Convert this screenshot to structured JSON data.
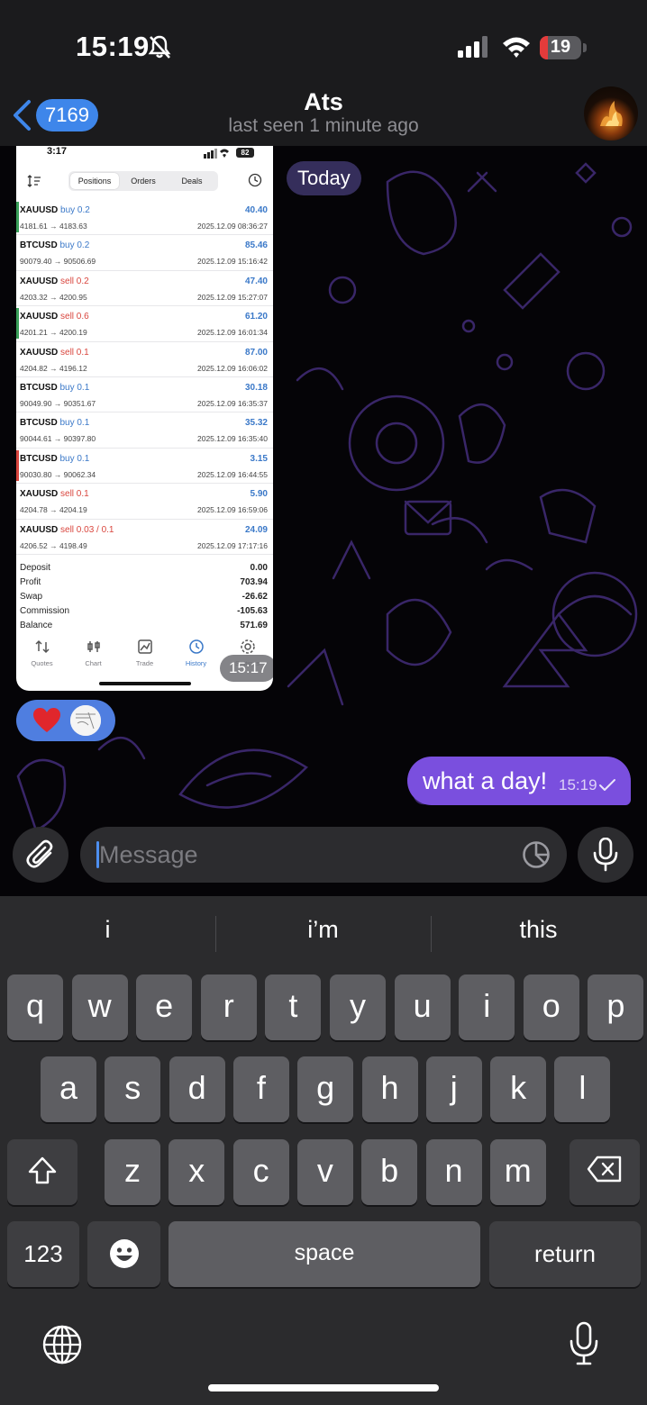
{
  "status_bar": {
    "time": "15:19",
    "battery": "19",
    "battery_level": 0.19
  },
  "header": {
    "back_badge": "7169",
    "title": "Ats",
    "subtitle": "last seen 1 minute ago"
  },
  "chat": {
    "date_label": "Today",
    "photo": {
      "status_time": "3:17",
      "status_battery": "82",
      "tabs": [
        "Positions",
        "Orders",
        "Deals"
      ],
      "deals": [
        {
          "symbol": "XAUUSD",
          "side": "buy 0.2",
          "prices": "4181.61 → 4183.63",
          "profit": "40.40",
          "datetime": "2025.12.09 08:36:27",
          "accent": "#3aa05a"
        },
        {
          "symbol": "BTCUSD",
          "side": "buy 0.2",
          "prices": "90079.40 → 90506.69",
          "profit": "85.46",
          "datetime": "2025.12.09 15:16:42",
          "accent": ""
        },
        {
          "symbol": "XAUUSD",
          "side": "sell 0.2",
          "prices": "4203.32 → 4200.95",
          "profit": "47.40",
          "datetime": "2025.12.09 15:27:07",
          "accent": ""
        },
        {
          "symbol": "XAUUSD",
          "side": "sell 0.6",
          "prices": "4201.21 → 4200.19",
          "profit": "61.20",
          "datetime": "2025.12.09 16:01:34",
          "accent": "#3aa05a"
        },
        {
          "symbol": "XAUUSD",
          "side": "sell 0.1",
          "prices": "4204.82 → 4196.12",
          "profit": "87.00",
          "datetime": "2025.12.09 16:06:02",
          "accent": ""
        },
        {
          "symbol": "BTCUSD",
          "side": "buy 0.1",
          "prices": "90049.90 → 90351.67",
          "profit": "30.18",
          "datetime": "2025.12.09 16:35:37",
          "accent": ""
        },
        {
          "symbol": "BTCUSD",
          "side": "buy 0.1",
          "prices": "90044.61 → 90397.80",
          "profit": "35.32",
          "datetime": "2025.12.09 16:35:40",
          "accent": ""
        },
        {
          "symbol": "BTCUSD",
          "side": "buy 0.1",
          "prices": "90030.80 → 90062.34",
          "profit": "3.15",
          "datetime": "2025.12.09 16:44:55",
          "accent": "#d9463e"
        },
        {
          "symbol": "XAUUSD",
          "side": "sell 0.1",
          "prices": "4204.78 → 4204.19",
          "profit": "5.90",
          "datetime": "2025.12.09 16:59:06",
          "accent": ""
        },
        {
          "symbol": "XAUUSD",
          "side": "sell 0.03 / 0.1",
          "prices": "4206.52 → 4198.49",
          "profit": "24.09",
          "datetime": "2025.12.09 17:17:16",
          "accent": ""
        }
      ],
      "summary": [
        {
          "label": "Deposit",
          "value": "0.00"
        },
        {
          "label": "Profit",
          "value": "703.94"
        },
        {
          "label": "Swap",
          "value": "-26.62"
        },
        {
          "label": "Commission",
          "value": "-105.63"
        },
        {
          "label": "Balance",
          "value": "571.69"
        }
      ],
      "tabbar": [
        "Quotes",
        "Chart",
        "Trade",
        "History",
        "Settings"
      ],
      "active_tab": "History",
      "time": "15:17"
    },
    "outgoing": {
      "text": "what a day!",
      "time": "15:19"
    }
  },
  "composer": {
    "placeholder": "Message"
  },
  "keyboard": {
    "suggestions": [
      "i",
      "i’m",
      "this"
    ],
    "row1": [
      "q",
      "w",
      "e",
      "r",
      "t",
      "y",
      "u",
      "i",
      "o",
      "p"
    ],
    "row2": [
      "a",
      "s",
      "d",
      "f",
      "g",
      "h",
      "j",
      "k",
      "l"
    ],
    "row3": [
      "z",
      "x",
      "c",
      "v",
      "b",
      "n",
      "m"
    ],
    "numbers_key": "123",
    "space_key": "space",
    "return_key": "return"
  },
  "colors": {
    "accent_blue": "#3e86ea",
    "outgoing_bubble": "#7a4fde",
    "buy": "#3a78c8",
    "sell": "#d9463e"
  }
}
